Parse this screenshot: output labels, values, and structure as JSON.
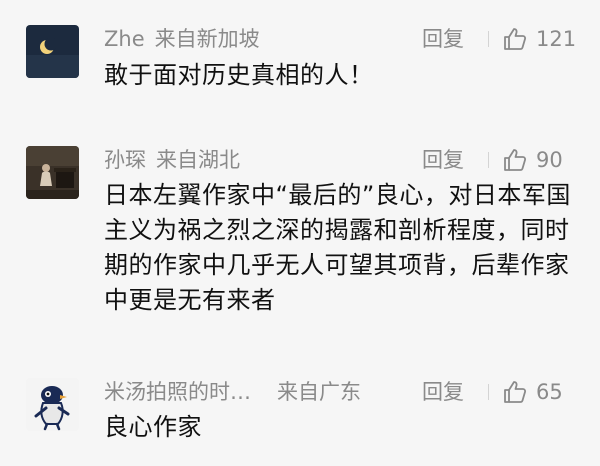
{
  "comments": [
    {
      "username": "Zhe",
      "region": "来自新加坡",
      "reply_label": "回复",
      "likes": "121",
      "text": "敢于面对历史真相的人！",
      "avatar_icon": "crescent-moon-night-avatar"
    },
    {
      "username": "孙琛",
      "region": "来自湖北",
      "reply_label": "回复",
      "likes": "90",
      "text": "日本左翼作家中“最后的”良心，对日本军国主义为祸之烈之深的揭露和剖析程度，同时期的作家中几乎无人可望其项背，后辈作家中更是无有来者",
      "avatar_icon": "pianist-photo-avatar"
    },
    {
      "username": "米汤拍照的时…",
      "region": "来自广东",
      "reply_label": "回复",
      "likes": "65",
      "text": "良心作家",
      "avatar_icon": "bird-mascot-avatar"
    }
  ],
  "colors": {
    "background": "#f6f6f6",
    "meta_text": "#8a8a8a",
    "body_text": "#111111"
  }
}
